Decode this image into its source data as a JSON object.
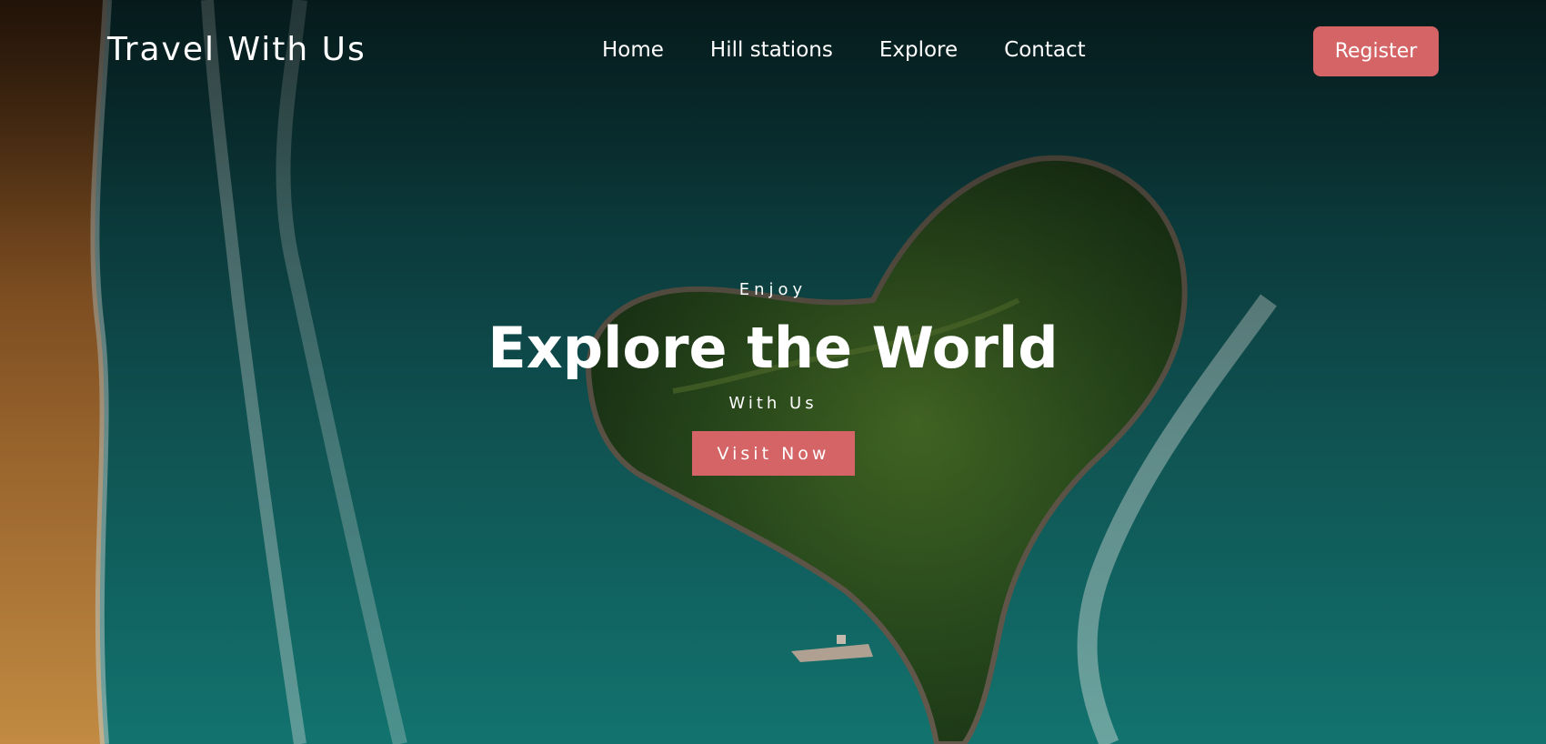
{
  "header": {
    "brand": "Travel With Us",
    "nav": [
      {
        "label": "Home"
      },
      {
        "label": "Hill stations"
      },
      {
        "label": "Explore"
      },
      {
        "label": "Contact"
      }
    ],
    "register_label": "Register"
  },
  "hero": {
    "eyebrow": "Enjoy",
    "headline": "Explore the World",
    "subline": "With Us",
    "cta_label": "Visit Now",
    "background_image": "aerial-ocean-heart-island"
  },
  "colors": {
    "accent": "#d46466",
    "ocean": "#0f4a4c",
    "sand": "#c9873f",
    "island": "#2f5a1f",
    "text": "#ffffff"
  }
}
